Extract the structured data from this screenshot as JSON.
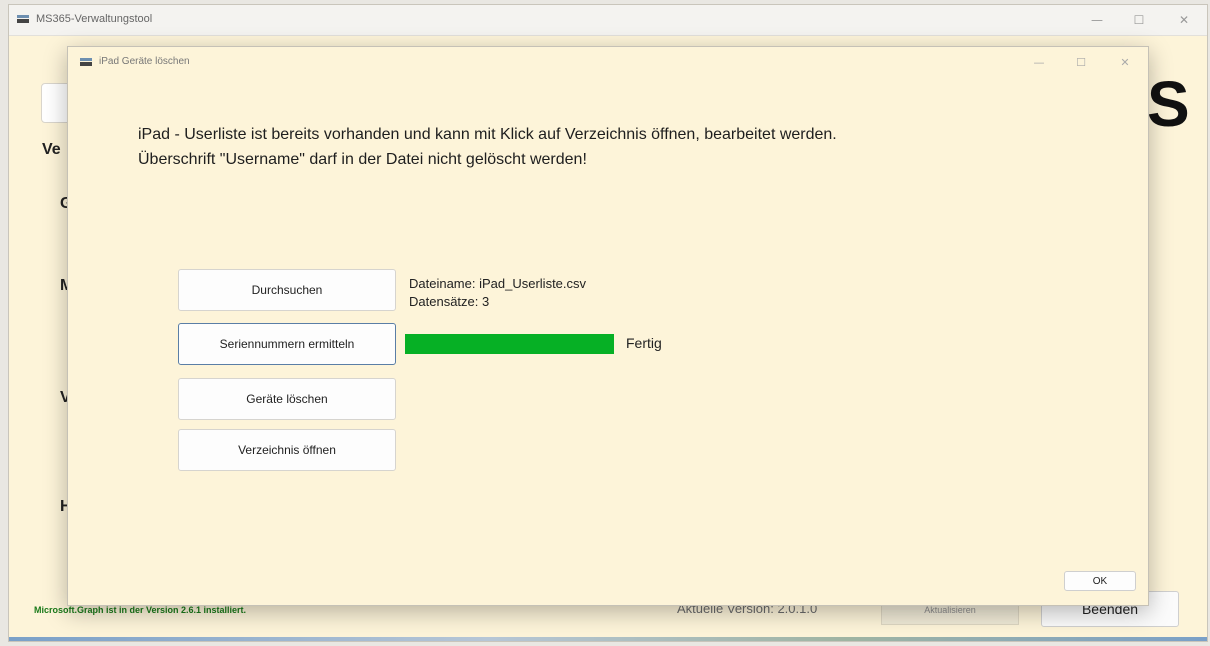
{
  "main_window": {
    "title": "MS365-Verwaltungstool",
    "icon": "app-icon",
    "controls": {
      "minimize": "—",
      "maximize": "☐",
      "close": "✕"
    },
    "background_letters": [
      "Ve",
      "G",
      "M",
      "V",
      "H"
    ],
    "big_letter": "S",
    "graph_status": "Microsoft.Graph ist in der Version 2.6.1 installiert.",
    "version_label": "Aktuelle Version: 2.0.1.0",
    "update_button_label": "Aktualisieren",
    "quit_button_label": "Beenden"
  },
  "dialog": {
    "title": "iPad Geräte löschen",
    "icon": "app-icon",
    "controls": {
      "minimize": "—",
      "maximize": "☐",
      "close": "✕"
    },
    "info_line_1": "iPad - Userliste ist bereits vorhanden und kann mit Klick auf Verzeichnis öffnen, bearbeitet werden.",
    "info_line_2": "Überschrift \"Username\" darf in der Datei nicht gelöscht werden!",
    "buttons": {
      "browse": "Durchsuchen",
      "get_serials": "Seriennummern ermitteln",
      "delete_devices": "Geräte löschen",
      "open_directory": "Verzeichnis öffnen",
      "ok": "OK"
    },
    "file_name": "Dateiname: iPad_Userliste.csv",
    "record_count": "Datensätze: 3",
    "progress": {
      "fraction": 1.0,
      "status": "Fertig",
      "fill_color": "#06b025"
    }
  },
  "colors": {
    "window_background": "#fdf4d9",
    "status_green": "#1a7a1a"
  }
}
